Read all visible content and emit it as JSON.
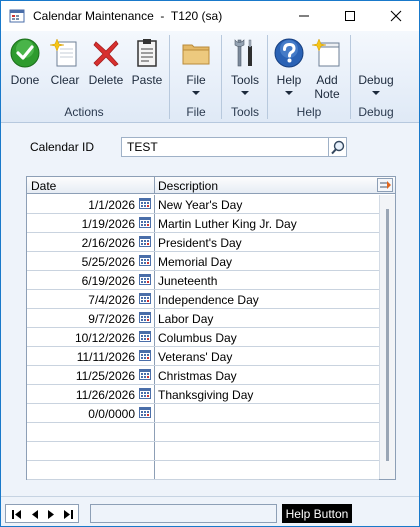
{
  "window": {
    "title": "Calendar Maintenance  -  T120 (sa)"
  },
  "ribbon": {
    "groups": [
      {
        "label": "Actions",
        "buttons": [
          {
            "label": "Done",
            "icon": "check-icon"
          },
          {
            "label": "Clear",
            "icon": "clear-page-icon"
          },
          {
            "label": "Delete",
            "icon": "delete-x-icon"
          },
          {
            "label": "Paste",
            "icon": "clipboard-icon"
          }
        ]
      },
      {
        "label": "File",
        "buttons": [
          {
            "label": "File",
            "icon": "folder-icon"
          }
        ]
      },
      {
        "label": "Tools",
        "buttons": [
          {
            "label": "Tools",
            "icon": "tools-icon"
          }
        ]
      },
      {
        "label": "Help",
        "buttons": [
          {
            "label": "Help",
            "icon": "help-icon"
          },
          {
            "label": "Add",
            "label2": "Note",
            "icon": "add-note-icon"
          }
        ]
      },
      {
        "label": "Debug",
        "buttons": [
          {
            "label": "Debug",
            "icon": "debug-icon"
          }
        ]
      }
    ]
  },
  "form": {
    "calendar_id_label": "Calendar ID",
    "calendar_id_value": "TEST"
  },
  "grid": {
    "columns": [
      "Date",
      "Description"
    ],
    "rows": [
      {
        "date": "1/1/2026",
        "description": "New Year's Day"
      },
      {
        "date": "1/19/2026",
        "description": "Martin Luther King Jr. Day"
      },
      {
        "date": "2/16/2026",
        "description": "President's Day"
      },
      {
        "date": "5/25/2026",
        "description": "Memorial Day"
      },
      {
        "date": "6/19/2026",
        "description": "Juneteenth"
      },
      {
        "date": "7/4/2026",
        "description": "Independence Day"
      },
      {
        "date": "9/7/2026",
        "description": "Labor Day"
      },
      {
        "date": "10/12/2026",
        "description": "Columbus Day"
      },
      {
        "date": "11/11/2026",
        "description": "Veterans' Day"
      },
      {
        "date": "11/25/2026",
        "description": "Christmas Day"
      },
      {
        "date": "11/26/2026",
        "description": "Thanksgiving Day"
      },
      {
        "date": "0/0/0000",
        "description": ""
      },
      {
        "date": "",
        "description": ""
      },
      {
        "date": "",
        "description": ""
      },
      {
        "date": "",
        "description": ""
      }
    ]
  },
  "footer": {
    "help_button": "Help Button"
  },
  "colors": {
    "accent": "#1979ca",
    "ribbon_bg": "#dfe9f6",
    "form_bg": "#eef3fa"
  }
}
